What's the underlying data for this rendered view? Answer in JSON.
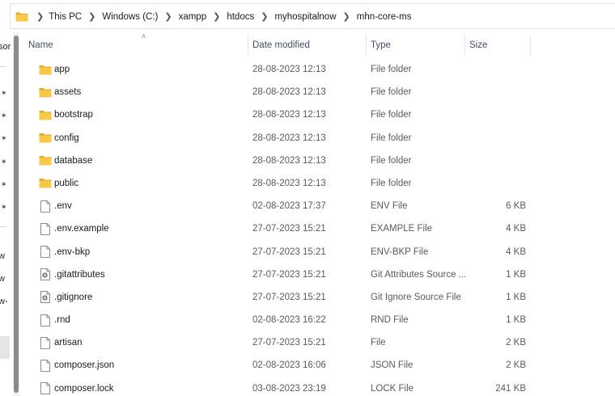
{
  "address_bar": {
    "crumbs": [
      "This PC",
      "Windows (C:)",
      "xampp",
      "htdocs",
      "myhospitalnow",
      "mhn-core-ms"
    ]
  },
  "nav_fragments": [
    "sor",
    "w",
    "w",
    "w-"
  ],
  "columns": {
    "name": "Name",
    "date": "Date modified",
    "type": "Type",
    "size": "Size"
  },
  "files": [
    {
      "name": "app",
      "date": "28-08-2023 12:13",
      "type": "File folder",
      "size": "",
      "icon": "folder-icon"
    },
    {
      "name": "assets",
      "date": "28-08-2023 12:13",
      "type": "File folder",
      "size": "",
      "icon": "folder-icon"
    },
    {
      "name": "bootstrap",
      "date": "28-08-2023 12:13",
      "type": "File folder",
      "size": "",
      "icon": "folder-icon"
    },
    {
      "name": "config",
      "date": "28-08-2023 12:13",
      "type": "File folder",
      "size": "",
      "icon": "folder-icon"
    },
    {
      "name": "database",
      "date": "28-08-2023 12:13",
      "type": "File folder",
      "size": "",
      "icon": "folder-icon"
    },
    {
      "name": "public",
      "date": "28-08-2023 12:13",
      "type": "File folder",
      "size": "",
      "icon": "folder-icon"
    },
    {
      "name": ".env",
      "date": "02-08-2023 17:37",
      "type": "ENV File",
      "size": "6 KB",
      "icon": "file-icon"
    },
    {
      "name": ".env.example",
      "date": "27-07-2023 15:21",
      "type": "EXAMPLE File",
      "size": "4 KB",
      "icon": "file-icon"
    },
    {
      "name": ".env-bkp",
      "date": "27-07-2023 15:21",
      "type": "ENV-BKP File",
      "size": "4 KB",
      "icon": "file-icon"
    },
    {
      "name": ".gitattributes",
      "date": "27-07-2023 15:21",
      "type": "Git Attributes Source ...",
      "size": "1 KB",
      "icon": "gear-file-icon"
    },
    {
      "name": ".gitignore",
      "date": "27-07-2023 15:21",
      "type": "Git Ignore Source File",
      "size": "1 KB",
      "icon": "gear-file-icon"
    },
    {
      "name": ".rnd",
      "date": "02-08-2023 16:22",
      "type": "RND File",
      "size": "1 KB",
      "icon": "file-icon"
    },
    {
      "name": "artisan",
      "date": "27-07-2023 15:21",
      "type": "File",
      "size": "2 KB",
      "icon": "file-icon"
    },
    {
      "name": "composer.json",
      "date": "02-08-2023 16:06",
      "type": "JSON File",
      "size": "2 KB",
      "icon": "file-icon"
    },
    {
      "name": "composer.lock",
      "date": "03-08-2023 23:19",
      "type": "LOCK File",
      "size": "241 KB",
      "icon": "file-icon"
    }
  ],
  "colors": {
    "folder": "#f7c948",
    "folder_dark": "#e6a919",
    "header_text": "#3f4f63"
  }
}
